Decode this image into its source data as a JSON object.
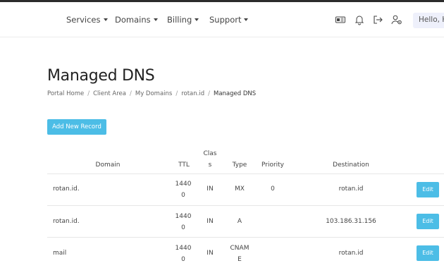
{
  "nav": {
    "menu": [
      {
        "label": "Services"
      },
      {
        "label": "Domains"
      },
      {
        "label": "Billing"
      },
      {
        "label": "Support"
      }
    ],
    "greeting": "Hello, H"
  },
  "page": {
    "title": "Managed DNS",
    "breadcrumb": [
      "Portal Home",
      "Client Area",
      "My Domains",
      "rotan.id",
      "Managed DNS"
    ]
  },
  "actions": {
    "add_record": "Add New Record"
  },
  "table": {
    "headers": {
      "domain": "Domain",
      "ttl": "TTL",
      "class_line1": "Clas",
      "class_line2": "s",
      "type": "Type",
      "priority": "Priority",
      "destination": "Destination"
    },
    "rows": [
      {
        "domain": "rotan.id.",
        "ttl1": "1440",
        "ttl2": "0",
        "cls": "IN",
        "type1": "MX",
        "type2": "",
        "priority": "0",
        "destination": "rotan.id",
        "edit": "Edit"
      },
      {
        "domain": "rotan.id.",
        "ttl1": "1440",
        "ttl2": "0",
        "cls": "IN",
        "type1": "A",
        "type2": "",
        "priority": "",
        "destination": "103.186.31.156",
        "edit": "Edit"
      },
      {
        "domain": "mail",
        "ttl1": "1440",
        "ttl2": "0",
        "cls": "IN",
        "type1": "CNAM",
        "type2": "E",
        "priority": "",
        "destination": "rotan.id",
        "edit": "Edit"
      }
    ]
  },
  "icons": [
    "language-icon",
    "bell-icon",
    "logout-icon",
    "user-settings-icon"
  ],
  "colors": {
    "accent": "#4cbde6",
    "topbar": "#2b2b2b",
    "hello_bg": "#eef0fb"
  }
}
